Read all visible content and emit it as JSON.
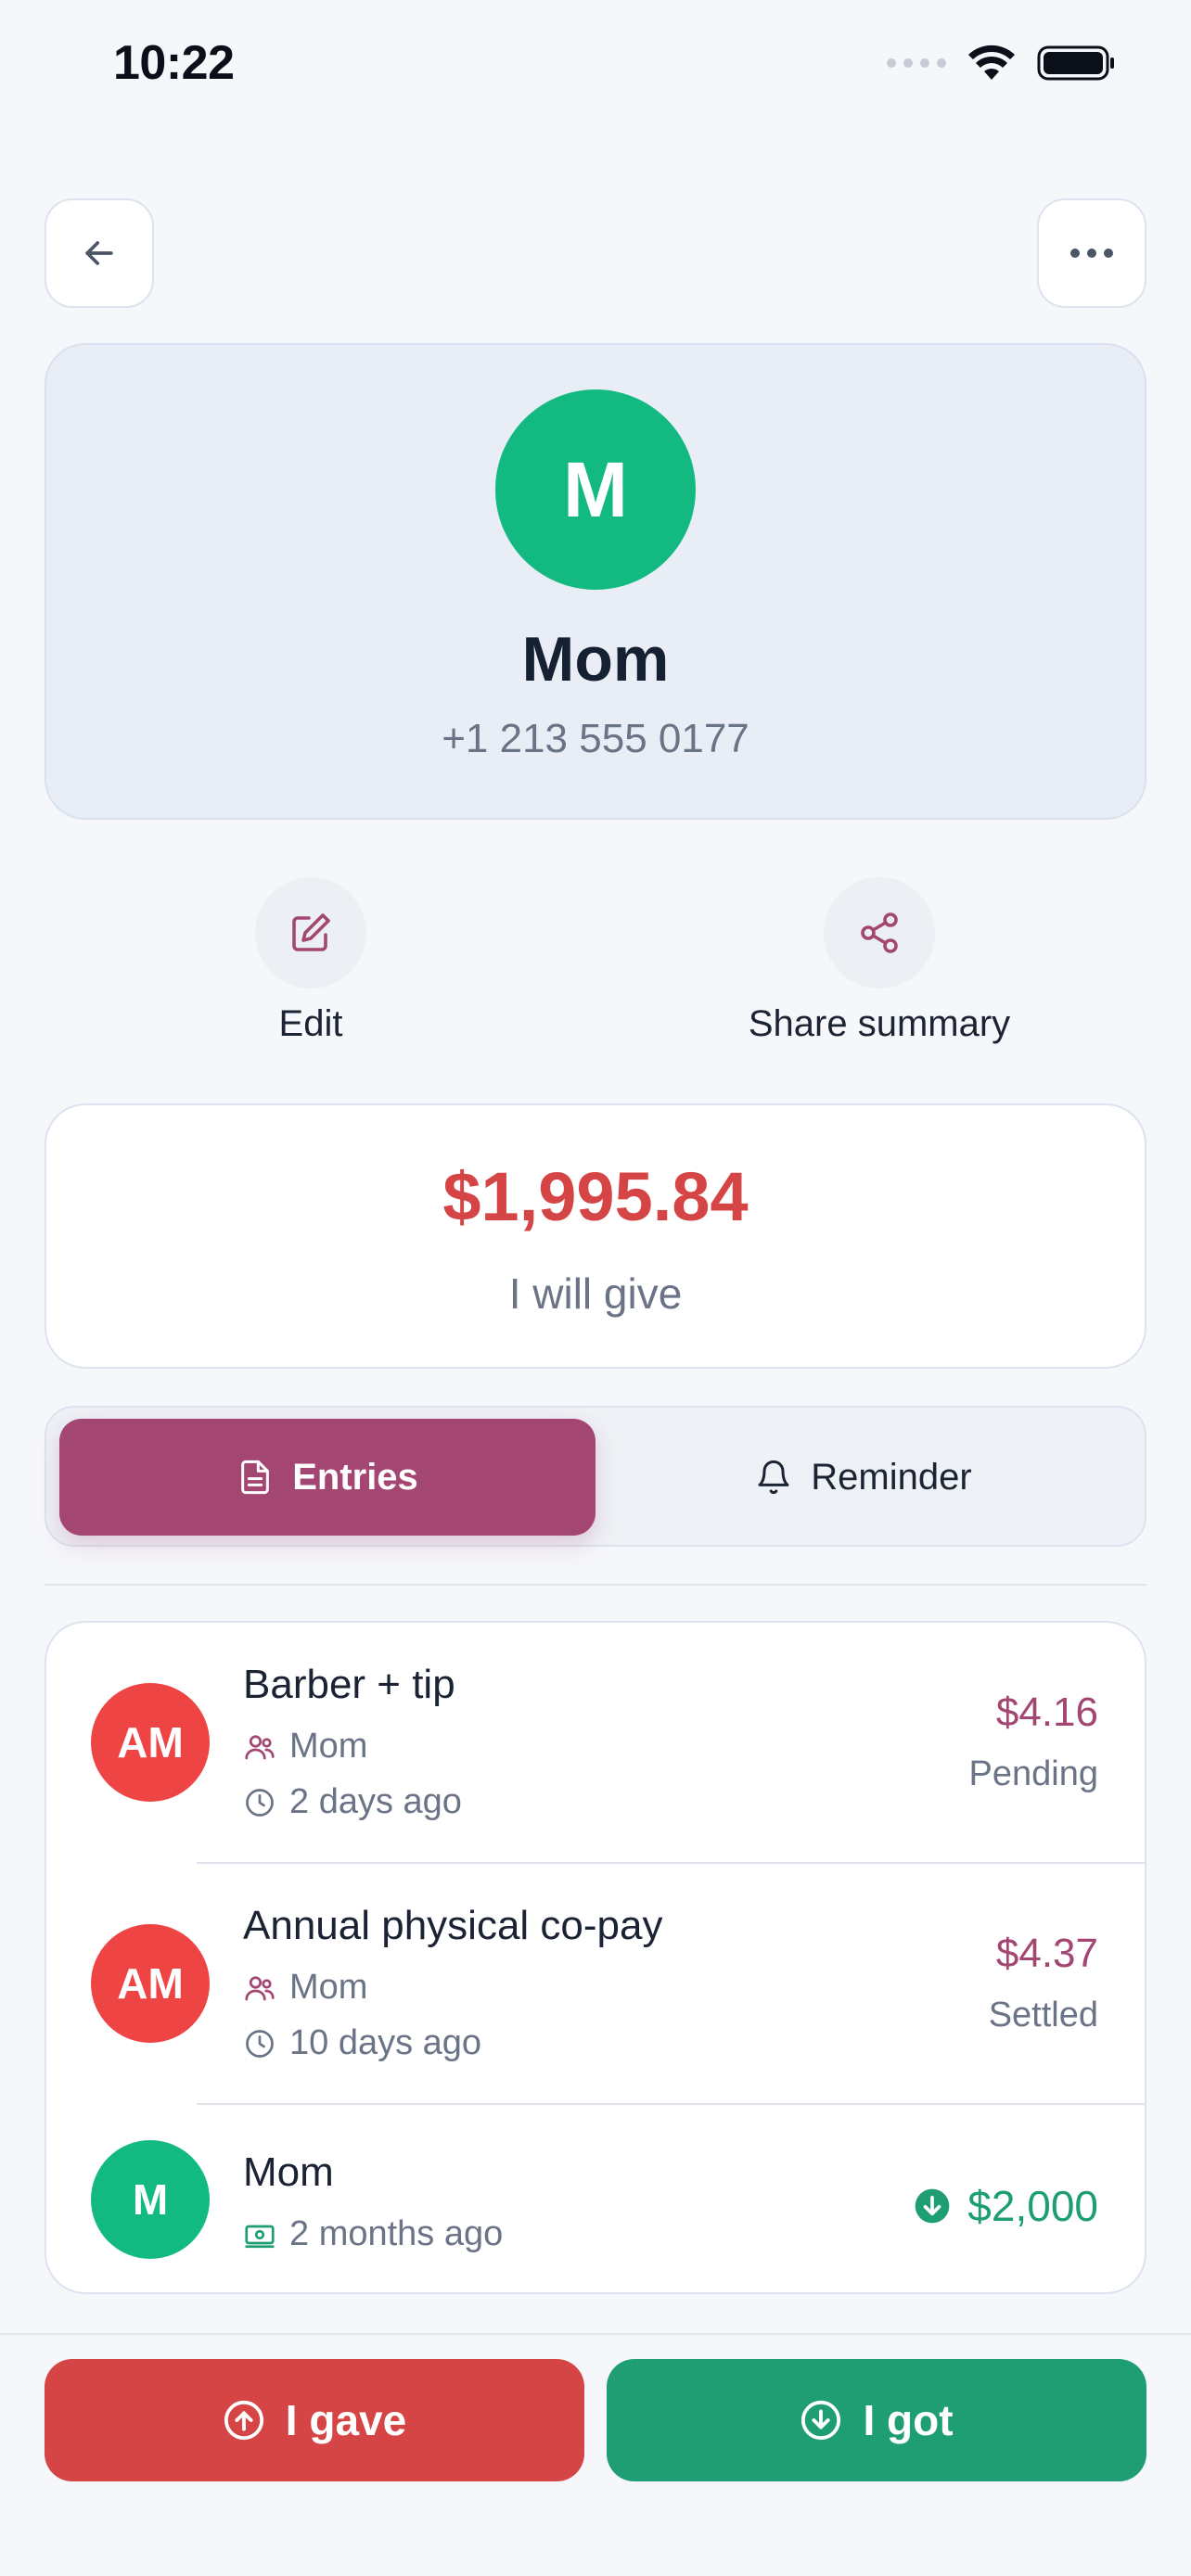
{
  "status_bar": {
    "time": "10:22"
  },
  "profile": {
    "initial": "M",
    "name": "Mom",
    "phone": "+1 213 555 0177",
    "avatar_color": "#12b981"
  },
  "actions": {
    "edit": "Edit",
    "share": "Share summary"
  },
  "balance": {
    "amount": "$1,995.84",
    "caption": "I will give",
    "color": "#d64545"
  },
  "tabs": {
    "entries": "Entries",
    "reminder": "Reminder",
    "active_color": "#a34672"
  },
  "entries": [
    {
      "initials": "AM",
      "title": "Barber + tip",
      "person": "Mom",
      "time": "2 days ago",
      "amount": "$4.16",
      "status": "Pending"
    },
    {
      "initials": "AM",
      "title": "Annual physical co-pay",
      "person": "Mom",
      "time": "10 days ago",
      "amount": "$4.37",
      "status": "Settled"
    },
    {
      "initials": "M",
      "title": "Mom",
      "time": "2 months ago",
      "amount": "$2,000"
    }
  ],
  "buttons": {
    "gave": "I gave",
    "got": "I got",
    "gave_color": "#d64545",
    "got_color": "#1f9e74"
  }
}
